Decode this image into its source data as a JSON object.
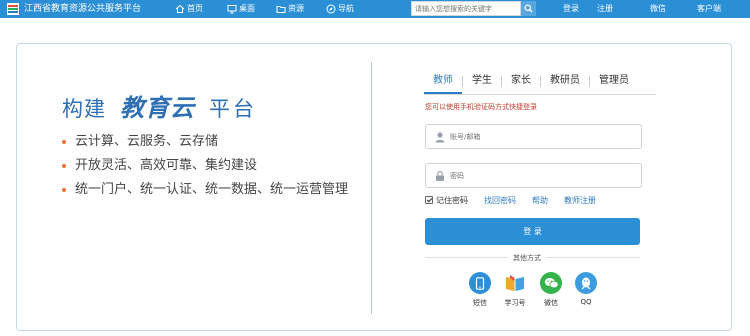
{
  "topbar": {
    "site_title": "江西省教育资源公共服务平台",
    "nav": [
      {
        "label": "首页",
        "icon": "home-icon"
      },
      {
        "label": "桌面",
        "icon": "monitor-icon"
      },
      {
        "label": "资源",
        "icon": "folder-icon"
      },
      {
        "label": "导航",
        "icon": "compass-icon"
      }
    ],
    "search_placeholder": "请输入您想搜索的关键字",
    "links": {
      "login": "登录",
      "register": "注册",
      "wechat": "微信",
      "client": "客户端"
    }
  },
  "hero": {
    "slogan_part1": "构建",
    "slogan_part2": "教育云",
    "slogan_part3": "平台",
    "features": [
      "云计算、云服务、云存储",
      "开放灵活、高效可靠、集约建设",
      "统一门户、统一认证、统一数据、统一运营管理"
    ]
  },
  "login": {
    "tabs": [
      "教师",
      "学生",
      "家长",
      "教研员",
      "管理员"
    ],
    "active_tab": "教师",
    "hint": "您可以使用手机验证码方式快捷登录",
    "account_placeholder": "账号/邮箱",
    "password_placeholder": "密码",
    "remember_label": "记住密码",
    "remember_checked": true,
    "forgot_label": "找回密码",
    "help_label": "帮助",
    "teacher_register_label": "教师注册",
    "submit_label": "登 录",
    "other_methods_label": "其他方式",
    "alt_methods": [
      {
        "label": "短信",
        "icon": "phone-icon",
        "color": "#2e8fd8"
      },
      {
        "label": "学习号",
        "icon": "book-icon",
        "color": "#f0a830"
      },
      {
        "label": "微信",
        "icon": "wechat-icon",
        "color": "#35b34a"
      },
      {
        "label": "QQ",
        "icon": "qq-icon",
        "color": "#3f9be0"
      }
    ]
  },
  "colors": {
    "brand_blue": "#2b8fd6",
    "slogan_blue": "#2f6fb3",
    "hint_red": "#c0392b",
    "bullet_orange": "#e9733a"
  }
}
